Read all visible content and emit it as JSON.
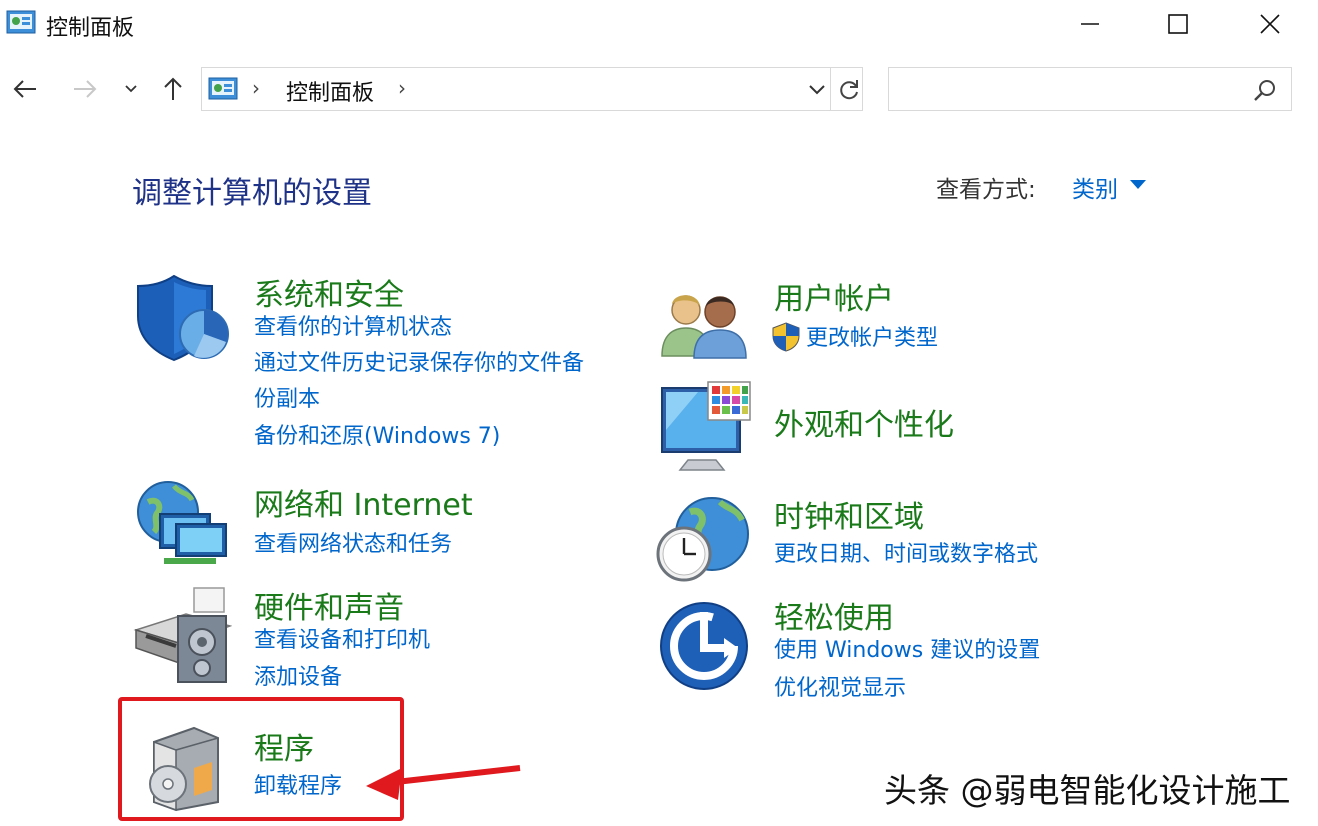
{
  "window": {
    "title": "控制面板"
  },
  "address_bar": {
    "crumb": "控制面板",
    "search_placeholder": ""
  },
  "header": {
    "title": "调整计算机的设置",
    "view_by_label": "查看方式:",
    "view_by_value": "类别"
  },
  "categories": {
    "system": {
      "title": "系统和安全",
      "links": [
        "查看你的计算机状态",
        "通过文件历史记录保存你的文件备",
        "份副本",
        "备份和还原(Windows 7)"
      ]
    },
    "network": {
      "title": "网络和 Internet",
      "links": [
        "查看网络状态和任务"
      ]
    },
    "hardware": {
      "title": "硬件和声音",
      "links": [
        "查看设备和打印机",
        "添加设备"
      ]
    },
    "programs": {
      "title": "程序",
      "links": [
        "卸载程序"
      ]
    },
    "accounts": {
      "title": "用户帐户",
      "links": [
        "更改帐户类型"
      ]
    },
    "appearance": {
      "title": "外观和个性化",
      "links": []
    },
    "clock": {
      "title": "时钟和区域",
      "links": [
        "更改日期、时间或数字格式"
      ]
    },
    "ease": {
      "title": "轻松使用",
      "links": [
        "使用 Windows 建议的设置",
        "优化视觉显示"
      ]
    }
  },
  "watermark": "头条 @弱电智能化设计施工",
  "colors": {
    "category_title": "#1a7a1a",
    "link": "#0066cc",
    "page_title": "#1e3287",
    "highlight": "#e0191e"
  }
}
